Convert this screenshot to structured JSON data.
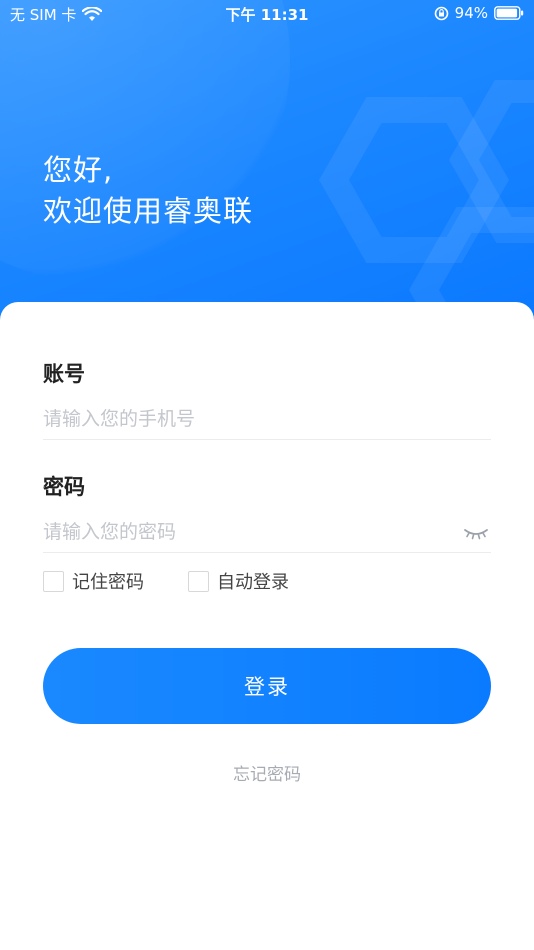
{
  "status_bar": {
    "carrier": "无 SIM 卡",
    "time": "下午 11:31",
    "battery": "94%",
    "icons": [
      "wifi-icon",
      "orientation-lock-icon",
      "battery-icon"
    ]
  },
  "greeting": {
    "line1": "您好,",
    "line2": "欢迎使用睿奥联"
  },
  "account": {
    "label": "账号",
    "placeholder": "请输入您的手机号",
    "value": ""
  },
  "password": {
    "label": "密码",
    "placeholder": "请输入您的密码",
    "value": "",
    "toggle_icon": "eye-closed-icon"
  },
  "options": {
    "remember_password": "记住密码",
    "remember_checked": false,
    "auto_login": "自动登录",
    "auto_login_checked": false
  },
  "login_button": "登录",
  "forgot_password": "忘记密码",
  "colors": {
    "primary": "#0A7BFF",
    "header_light": "#2F95FF",
    "placeholder": "#C3C6CC",
    "link": "#A7ABB2"
  }
}
